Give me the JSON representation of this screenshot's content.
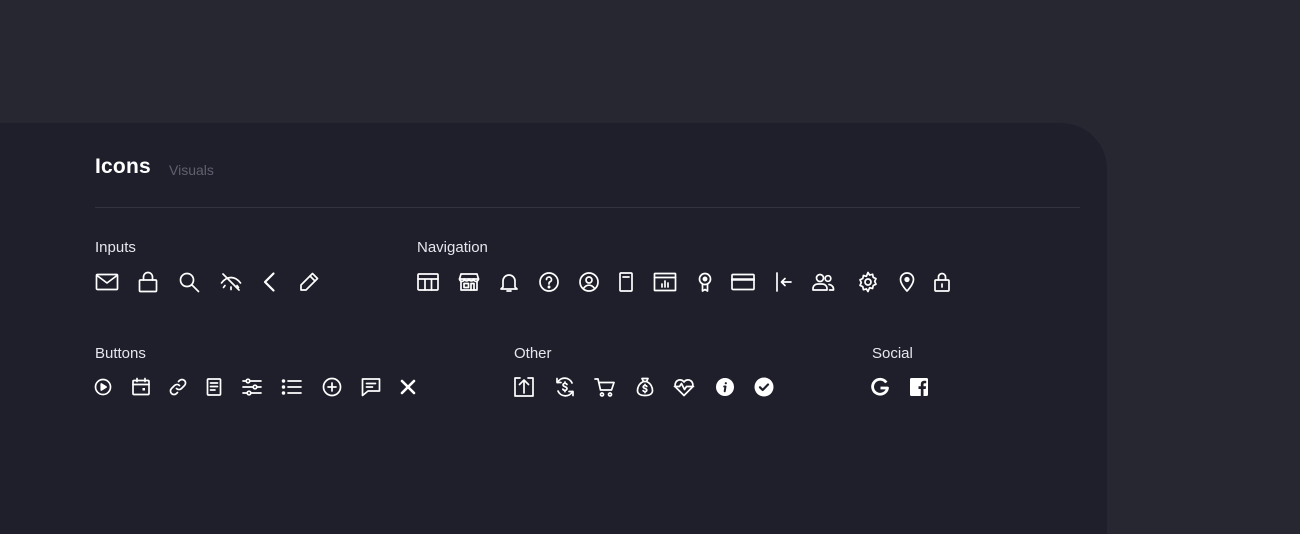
{
  "header": {
    "title": "Icons",
    "subtitle": "Visuals"
  },
  "groups": {
    "inputs": {
      "label": "Inputs",
      "icons": [
        "mail-icon",
        "lock-icon",
        "search-icon",
        "eye-off-icon",
        "chevron-left-icon",
        "pencil-icon"
      ]
    },
    "navigation": {
      "label": "Navigation",
      "icons": [
        "table-icon",
        "store-icon",
        "bell-icon",
        "help-icon",
        "user-circle-icon",
        "document-icon",
        "dashboard-chart-icon",
        "award-icon",
        "credit-card-icon",
        "arrow-left-collapse-icon",
        "users-icon",
        "gear-icon",
        "location-pin-icon",
        "padlock-icon"
      ]
    },
    "buttons": {
      "label": "Buttons",
      "icons": [
        "play-circle-icon",
        "calendar-icon",
        "link-icon",
        "note-icon",
        "sliders-icon",
        "list-icon",
        "plus-circle-icon",
        "chat-icon",
        "close-icon"
      ]
    },
    "other": {
      "label": "Other",
      "icons": [
        "upload-icon",
        "refresh-dollar-icon",
        "cart-icon",
        "money-bag-icon",
        "heart-pulse-icon",
        "info-icon",
        "check-circle-icon"
      ]
    },
    "social": {
      "label": "Social",
      "icons": [
        "google-icon",
        "facebook-icon"
      ]
    }
  },
  "colors": {
    "page_bg": "#272732",
    "card_bg": "#1f1f2c",
    "icon": "#ffffff",
    "subtitle": "#5f5f6e"
  }
}
